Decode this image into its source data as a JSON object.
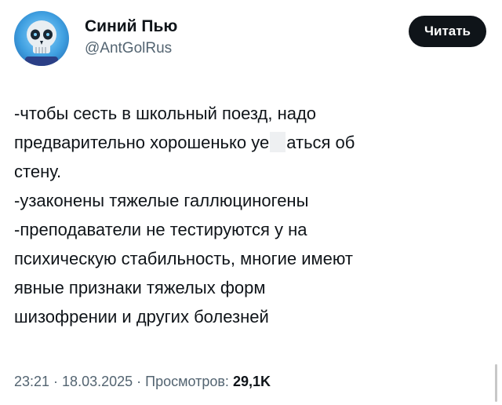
{
  "author": {
    "name": "Синий Пью",
    "handle": "@AntGolRus",
    "avatar_icon": "blue-skull-avatar-icon"
  },
  "follow_button": {
    "label": "Читать"
  },
  "tweet": {
    "lines": [
      "-чтобы сесть в школьный поезд, надо",
      {
        "before": "предварительно хорошенько уе",
        "after": "аться об"
      },
      "стену.",
      "-узаконены тяжелые галлюциногены",
      "-преподаватели не тестируются у на",
      "психическую стабильность, многие имеют",
      "явные признаки тяжелых форм",
      "шизофрении и других болезней"
    ]
  },
  "meta": {
    "time": "23:21",
    "date": "18.03.2025",
    "views_label": "Просмотров:",
    "views_count": "29,1K",
    "separator": " · "
  }
}
